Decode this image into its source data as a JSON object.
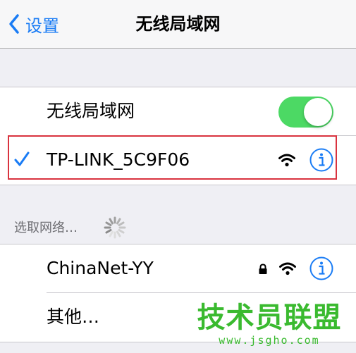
{
  "nav": {
    "back_label": "设置",
    "title": "无线局域网"
  },
  "wifi_section": {
    "toggle_label": "无线局域网",
    "toggle_on": true,
    "connected_network": "TP-LINK_5C9F06"
  },
  "choose_section": {
    "header": "选取网络…",
    "networks": [
      {
        "name": "ChinaNet-YY",
        "secured": true
      },
      {
        "name": "其他…"
      }
    ]
  },
  "watermark": {
    "title": "技术员联盟",
    "url": "www.jsgho.com"
  },
  "colors": {
    "accent": "#1a7cf5",
    "toggle_on": "#4cd964",
    "highlight_border": "#d9333f",
    "watermark": "#3aba2f"
  }
}
